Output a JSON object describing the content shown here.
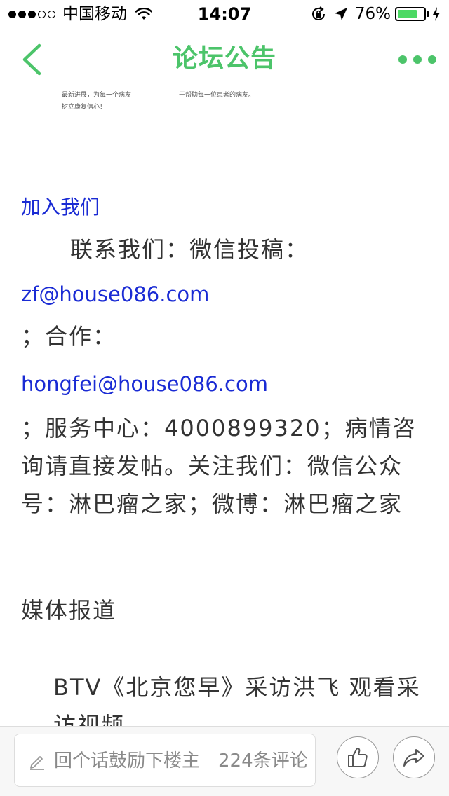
{
  "status_bar": {
    "carrier": "中国移动",
    "time": "14:07",
    "battery_percent_text": "76%",
    "battery_level": 0.76,
    "signal_bars_filled": 3,
    "signal_bars_total": 5
  },
  "nav": {
    "title": "论坛公告",
    "accent_color": "#4cc46a"
  },
  "content": {
    "tiny_left_line1": "最新进展，为每一个病友",
    "tiny_left_line2": "树立康复信心！",
    "tiny_right_line1": "于帮助每一位患者的病友。",
    "join_link": "加入我们",
    "contact_line": "联系我们：微信投稿：",
    "email_submit": "zf@house086.com",
    "cooperation_line": "；合作：",
    "email_coop": "hongfei@house086.com",
    "service_text": "；服务中心：4000899320；病情咨询请直接发帖。关注我们：微信公众号：淋巴瘤之家；微博：淋巴瘤之家",
    "media_heading": "媒体报道",
    "btv_text": "BTV《北京您早》采访洪飞 观看采访视频",
    "link_color": "#1a2bd4"
  },
  "bottom_bar": {
    "comment_placeholder": "回个话鼓励下楼主",
    "comment_count": "224条评论"
  },
  "icons": {
    "back": "chevron-left-icon",
    "more": "more-dots-icon",
    "pencil": "pencil-icon",
    "like": "thumbs-up-icon",
    "share": "share-arrow-icon",
    "wifi": "wifi-icon",
    "location": "location-arrow-icon",
    "rotation_lock": "rotation-lock-icon",
    "battery": "battery-icon"
  }
}
